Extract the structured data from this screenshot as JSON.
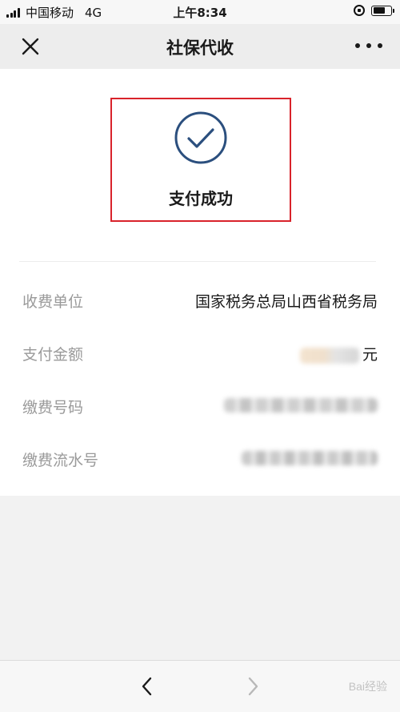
{
  "status_bar": {
    "carrier": "中国移动",
    "network": "4G",
    "time": "上午8:34"
  },
  "nav": {
    "title": "社保代收",
    "close_icon": "close-icon",
    "more_icon": "more-icon"
  },
  "result": {
    "icon": "check-circle-icon",
    "text": "支付成功",
    "accent_color": "#2b4f7e",
    "highlight_color": "#d9232b"
  },
  "details": [
    {
      "label": "收费单位",
      "value": "国家税务总局山西省税务局"
    },
    {
      "label": "支付金额",
      "value": "元"
    },
    {
      "label": "缴费号码",
      "value": ""
    },
    {
      "label": "缴费流水号",
      "value": ""
    }
  ],
  "toolbar": {
    "back_icon": "chevron-left-icon",
    "forward_icon": "chevron-right-icon"
  },
  "watermark": "Bai经验"
}
